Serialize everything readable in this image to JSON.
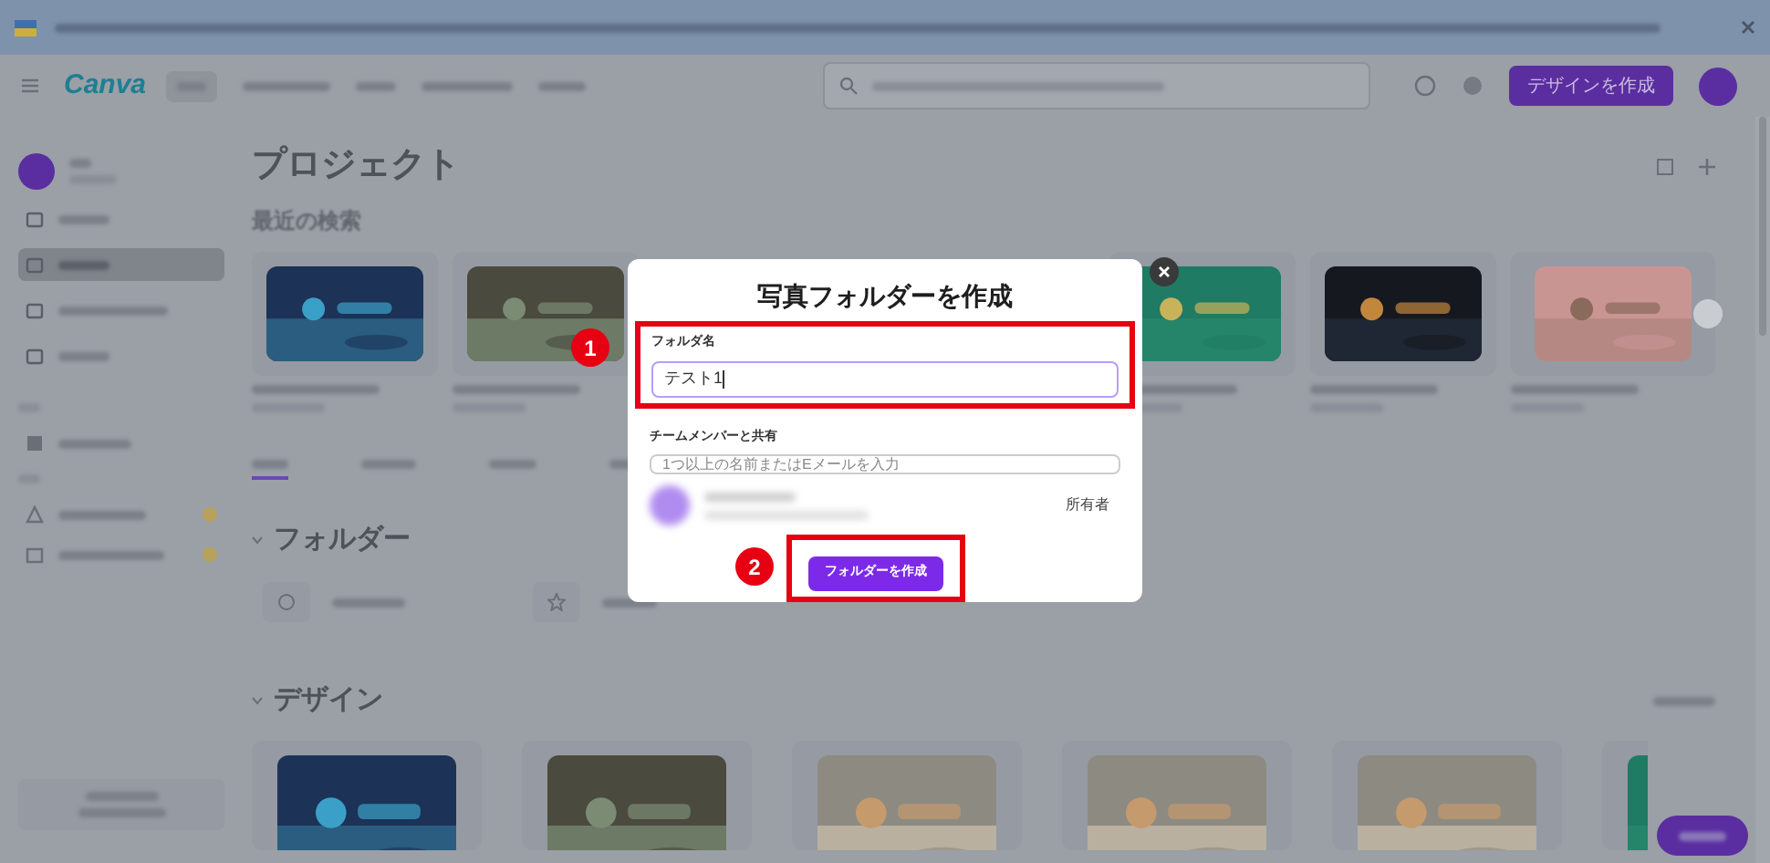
{
  "page": {
    "logo": "Canva",
    "create_design_button": "デザインを作成",
    "title": "プロジェクト",
    "recent_heading": "最近の検索",
    "folders_heading": "フォルダー",
    "designs_heading": "デザイン",
    "sidebar_items": [
      {
        "selected": false
      },
      {
        "selected": true
      },
      {
        "selected": false
      },
      {
        "selected": false
      }
    ],
    "filter_tabs": [
      {
        "selected": true
      },
      {
        "selected": false
      },
      {
        "selected": false
      },
      {
        "selected": false
      }
    ]
  },
  "dialog": {
    "title": "写真フォルダーを作成",
    "name_label": "フォルダ名",
    "name_value": "テスト1",
    "share_label": "チームメンバーと共有",
    "share_placeholder": "1つ以上の名前またはEメールを入力",
    "owner_role": "所有者",
    "create_button": "フォルダーを作成"
  },
  "callouts": [
    {
      "number": "1"
    },
    {
      "number": "2"
    }
  ]
}
